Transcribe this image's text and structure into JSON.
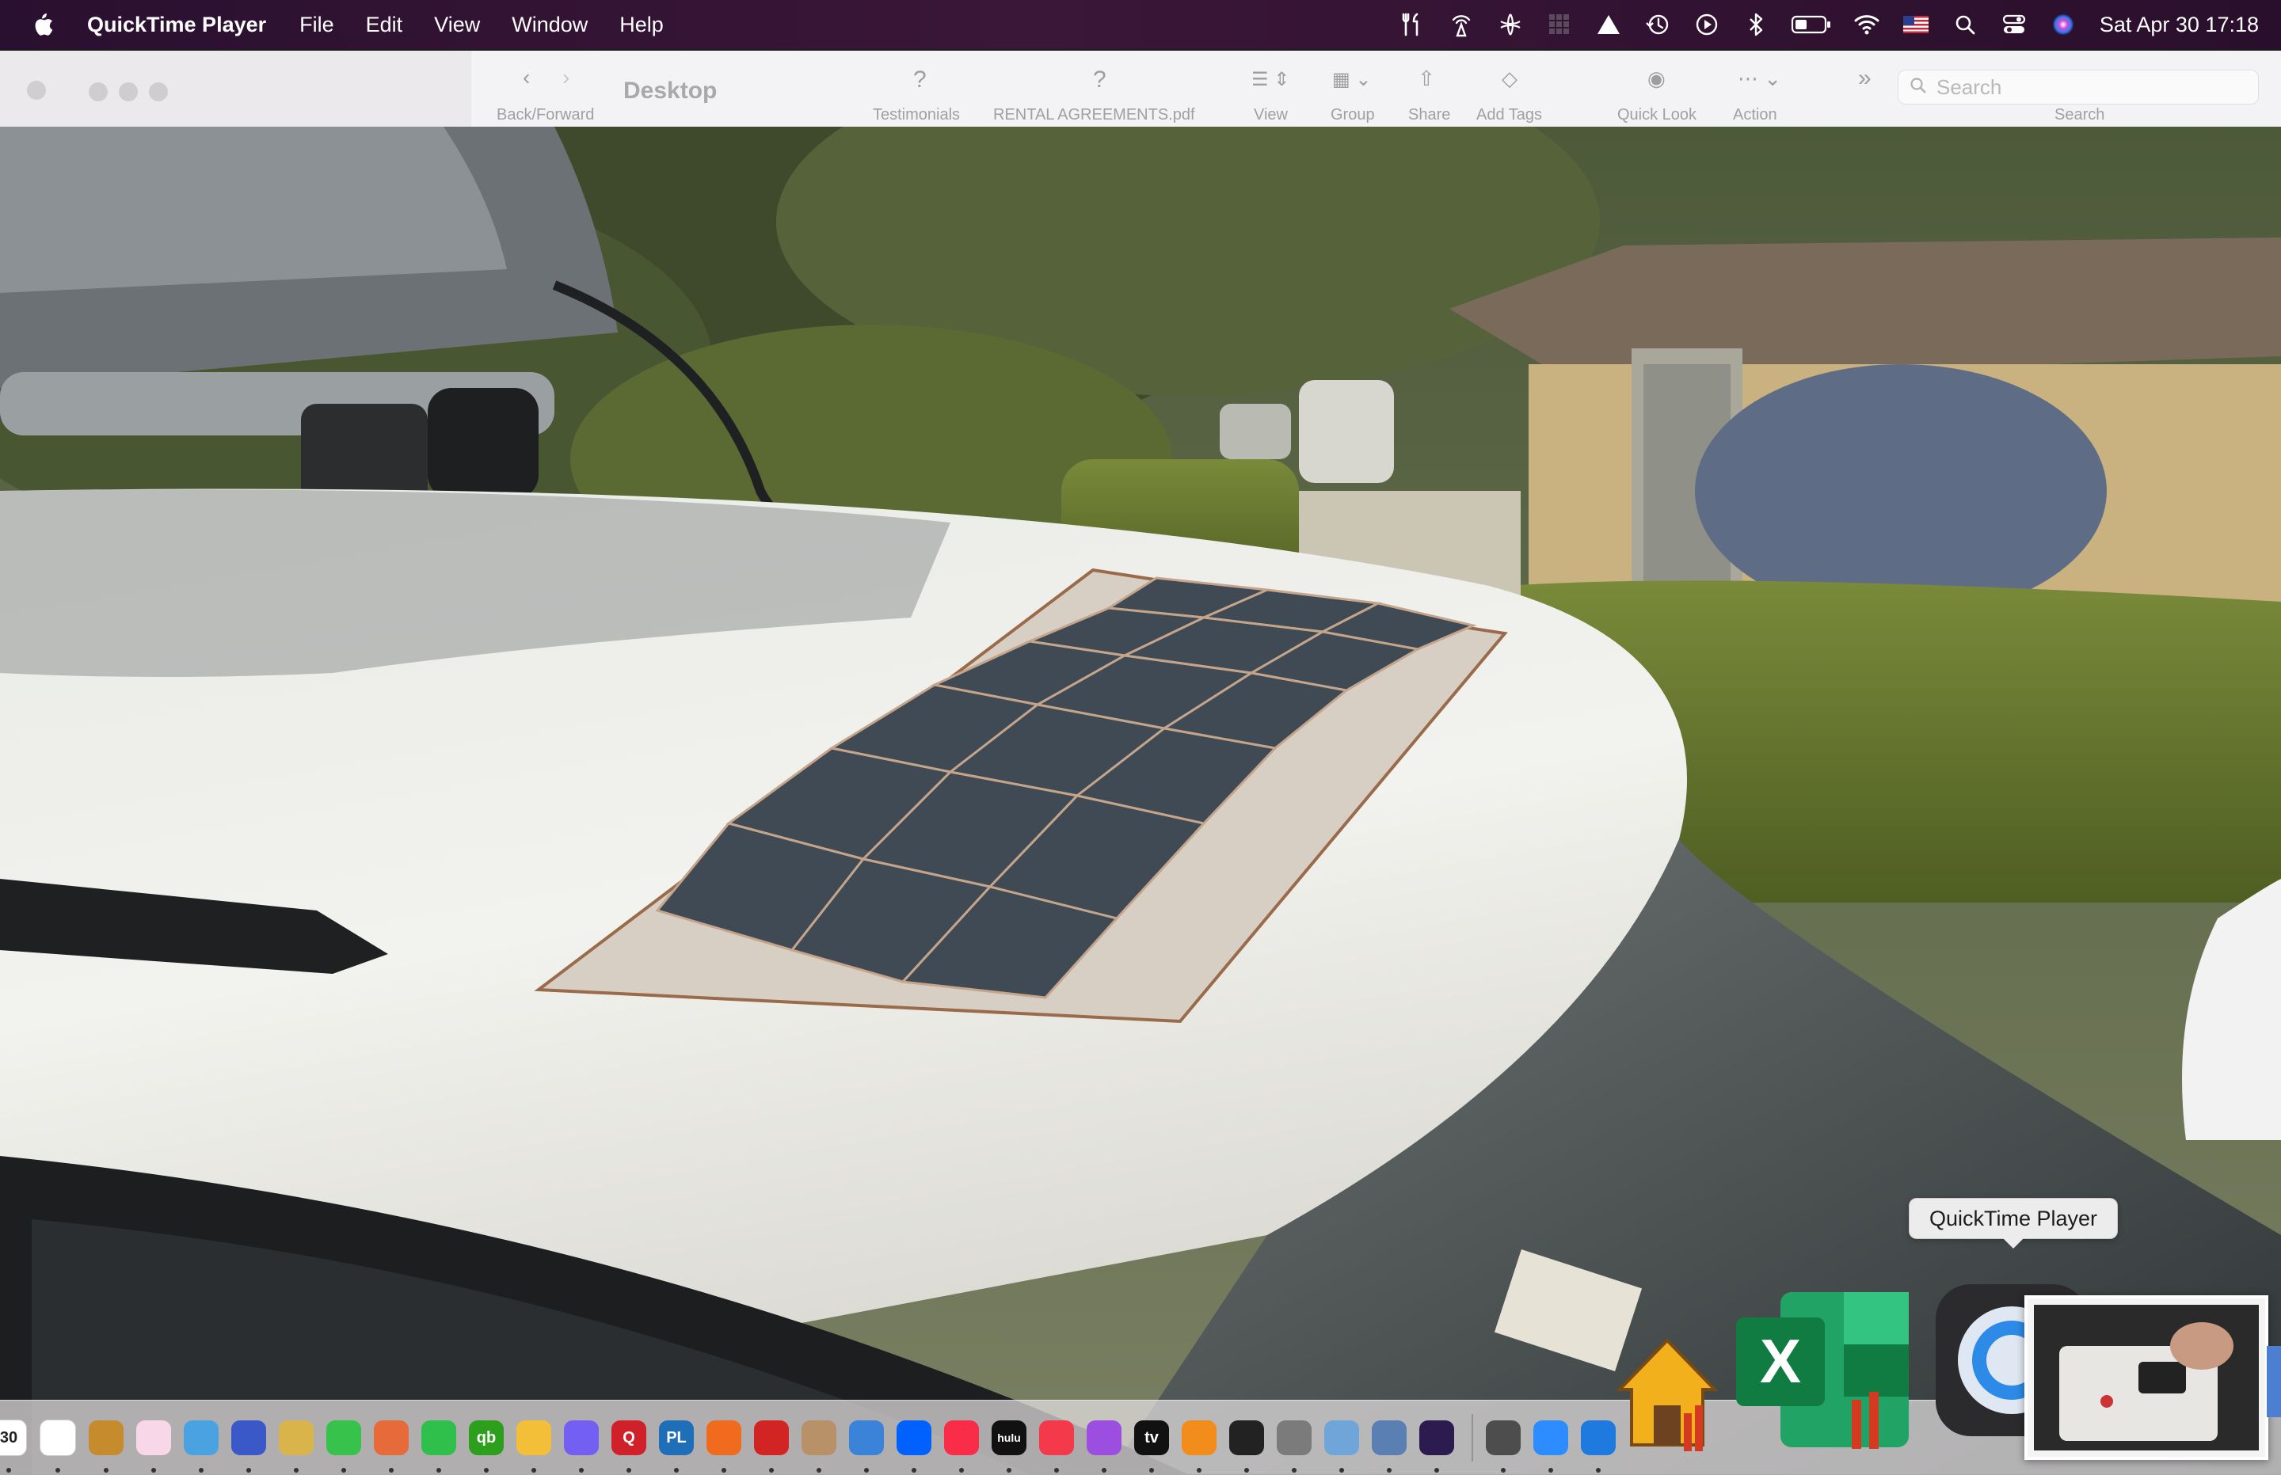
{
  "menubar": {
    "app_name": "QuickTime Player",
    "menus": [
      "File",
      "Edit",
      "View",
      "Window",
      "Help"
    ],
    "status_icons": [
      "tools-icon",
      "wifi-tower-icon",
      "cloud-sync-icon",
      "grid-icon",
      "drive-icon",
      "time-machine-icon",
      "play-circle-icon",
      "bluetooth-icon",
      "battery-icon",
      "wifi-icon",
      "us-flag-icon",
      "search-icon",
      "control-center-icon",
      "siri-icon"
    ],
    "clock": "Sat Apr 30  17:18"
  },
  "finder": {
    "title": "Desktop",
    "back_forward_label": "Back/Forward",
    "toolbar": {
      "item1": "Testimonials",
      "item2": "RENTAL AGREEMENTS.pdf",
      "view": "View",
      "group": "Group",
      "share": "Share",
      "add_tags": "Add Tags",
      "quick_look": "Quick Look",
      "action": "Action"
    },
    "search_placeholder": "Search",
    "search_label": "Search"
  },
  "tooltip": "QuickTime Player",
  "video": {
    "scene": "car-roof-solar-panel"
  },
  "dock": {
    "apps": [
      {
        "name": "calendar-icon",
        "color": "#ffffff",
        "label": "30"
      },
      {
        "name": "chrome-icon",
        "color": "#ffffff"
      },
      {
        "name": "pill-app-icon",
        "color": "#c58b2c"
      },
      {
        "name": "photos-icon",
        "color": "#f7d7e8"
      },
      {
        "name": "globe-app-icon",
        "color": "#4aa3e0"
      },
      {
        "name": "calculator-app-icon",
        "color": "#3a58c8"
      },
      {
        "name": "pineapple-icon",
        "color": "#d8b44a"
      },
      {
        "name": "facetime-icon",
        "color": "#37c34b"
      },
      {
        "name": "grid-app-icon",
        "color": "#e66a3a"
      },
      {
        "name": "chat-bubble-icon",
        "color": "#2fbf4b"
      },
      {
        "name": "quickbooks-icon",
        "color": "#2ca01c",
        "label": "qb"
      },
      {
        "name": "scissors-app-icon",
        "color": "#f3bf39"
      },
      {
        "name": "viber-icon",
        "color": "#7360f2"
      },
      {
        "name": "quicken-icon",
        "color": "#d0202a",
        "label": "Q"
      },
      {
        "name": "plex-icon",
        "color": "#1f6fb8",
        "label": "PL"
      },
      {
        "name": "firefox-icon",
        "color": "#f06b1d"
      },
      {
        "name": "red-app-icon",
        "color": "#d32424"
      },
      {
        "name": "contacts-icon",
        "color": "#b89169"
      },
      {
        "name": "screen-app-icon",
        "color": "#3b82d9"
      },
      {
        "name": "dropbox-icon",
        "color": "#0061fe"
      },
      {
        "name": "music-icon",
        "color": "#fa2d48"
      },
      {
        "name": "hulu-icon",
        "color": "#111111",
        "label": "hulu"
      },
      {
        "name": "news-icon",
        "color": "#f4394b"
      },
      {
        "name": "podcasts-icon",
        "color": "#9b4ee0"
      },
      {
        "name": "apple-tv-icon",
        "color": "#111111",
        "label": "tv"
      },
      {
        "name": "books-icon",
        "color": "#f28c1a"
      },
      {
        "name": "clock-app-icon",
        "color": "#222222"
      },
      {
        "name": "settings-icon",
        "color": "#7b7b7b"
      },
      {
        "name": "preview-icon",
        "color": "#6fa5d8"
      },
      {
        "name": "screen-sharing-icon",
        "color": "#5a7fb3"
      },
      {
        "name": "affinity-icon",
        "color": "#2b1b4e"
      }
    ],
    "apps_after_separator": [
      {
        "name": "calculator-icon",
        "color": "#4d4d4d"
      },
      {
        "name": "zoom-icon",
        "color": "#2d8cff"
      },
      {
        "name": "windows-app-icon",
        "color": "#1f7ae0"
      }
    ],
    "large": {
      "home_app": "home-app-icon",
      "excel": "excel-icon",
      "excel_letter": "X",
      "quicktime": "quicktime-icon",
      "preview_thumb": "video-thumbnail"
    }
  }
}
